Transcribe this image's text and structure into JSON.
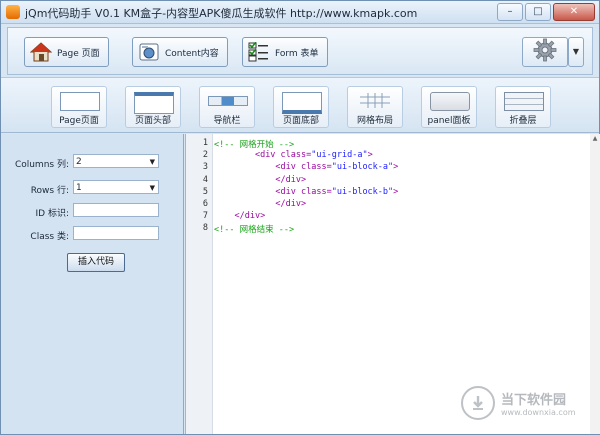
{
  "window": {
    "title": "jQm代码助手 V0.1   KM盒子-内容型APK傻瓜生成软件 http://www.kmapk.com",
    "minimize_label": "–",
    "maximize_label": "□",
    "close_label": "✕"
  },
  "toolbar": {
    "buttons": [
      {
        "label": "Page 页面",
        "icon": "house-icon"
      },
      {
        "label": "Content内容",
        "icon": "content-icon"
      },
      {
        "label": "Form 表单",
        "icon": "checklist-icon"
      }
    ],
    "settings_icon": "gear-icon",
    "dropdown_glyph": "▼"
  },
  "widgets": [
    {
      "label": "Page页面"
    },
    {
      "label": "页面头部"
    },
    {
      "label": "导航栏"
    },
    {
      "label": "页面底部"
    },
    {
      "label": "网格布局"
    },
    {
      "label": "panel面板"
    },
    {
      "label": "折叠层"
    }
  ],
  "form": {
    "columns_label": "Columns 列:",
    "columns_value": "2",
    "rows_label": "Rows 行:",
    "rows_value": "1",
    "id_label": "ID 标识:",
    "id_value": "",
    "class_label": "Class 类:",
    "class_value": "",
    "insert_label": "插入代码"
  },
  "editor": {
    "lines": [
      {
        "n": "1",
        "indent": "",
        "parts": [
          {
            "t": "<!-- 网格开始 -->",
            "c": "c-com"
          }
        ]
      },
      {
        "n": "2",
        "indent": "        ",
        "parts": [
          {
            "t": "<div ",
            "c": "c-tag"
          },
          {
            "t": "class=",
            "c": "c-attr"
          },
          {
            "t": "\"ui-grid-a\"",
            "c": "c-str"
          },
          {
            "t": ">",
            "c": "c-tag"
          }
        ]
      },
      {
        "n": "3",
        "indent": "            ",
        "parts": [
          {
            "t": "<div ",
            "c": "c-tag"
          },
          {
            "t": "class=",
            "c": "c-attr"
          },
          {
            "t": "\"ui-block-a\"",
            "c": "c-str"
          },
          {
            "t": ">",
            "c": "c-tag"
          }
        ]
      },
      {
        "n": "4",
        "indent": "            ",
        "parts": [
          {
            "t": "</div>",
            "c": "c-tag"
          }
        ]
      },
      {
        "n": "5",
        "indent": "            ",
        "parts": [
          {
            "t": "<div ",
            "c": "c-tag"
          },
          {
            "t": "class=",
            "c": "c-attr"
          },
          {
            "t": "\"ui-block-b\"",
            "c": "c-str"
          },
          {
            "t": ">",
            "c": "c-tag"
          }
        ]
      },
      {
        "n": "6",
        "indent": "            ",
        "parts": [
          {
            "t": "</div>",
            "c": "c-tag"
          }
        ]
      },
      {
        "n": "7",
        "indent": "    ",
        "parts": [
          {
            "t": "</div>",
            "c": "c-tag"
          }
        ]
      },
      {
        "n": "8",
        "indent": "",
        "parts": [
          {
            "t": "<!-- 网格结束 -->",
            "c": "c-com"
          }
        ]
      }
    ],
    "scroll_up_glyph": "▲"
  },
  "watermark": {
    "cn": "当下软件园",
    "en": "www.downxia.com"
  }
}
